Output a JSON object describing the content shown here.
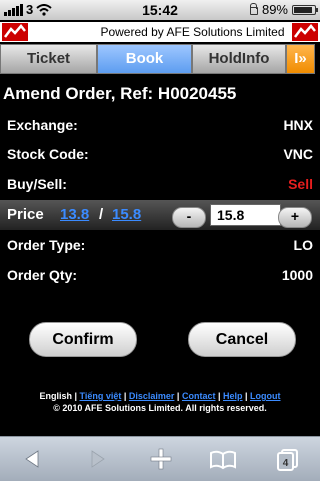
{
  "status_bar": {
    "carrier": "3",
    "time": "15:42",
    "battery": "89%",
    "battery_level": 0.89
  },
  "brand": {
    "powered_by": "Powered by AFE Solutions Limited"
  },
  "tabs": [
    {
      "label": "Ticket",
      "active": false
    },
    {
      "label": "Book",
      "active": true
    },
    {
      "label": "HoldInfo",
      "active": false
    },
    {
      "label": "I»",
      "active": false
    }
  ],
  "order": {
    "title": "Amend Order, Ref: H0020455",
    "fields": [
      {
        "label": "Exchange:",
        "value": "HNX"
      },
      {
        "label": "Stock Code:",
        "value": "VNC"
      },
      {
        "label": "Buy/Sell:",
        "value": "Sell"
      },
      {
        "label": "Order Type:",
        "value": "LO"
      },
      {
        "label": "Order Qty:",
        "value": "1000"
      }
    ],
    "price": {
      "label": "Price",
      "bid": "13.8",
      "separator": "/",
      "ask": "15.8",
      "minus": "-",
      "plus": "+",
      "value": "15.8"
    }
  },
  "actions": {
    "confirm": "Confirm",
    "cancel": "Cancel"
  },
  "footer": {
    "links": [
      "English",
      "Tiếng việt",
      "Disclaimer",
      "Contact",
      "Help",
      "Logout"
    ],
    "separator": " | ",
    "copyright": "© 2010 AFE Solutions Limited. All rights reserved."
  },
  "toolbar": {
    "icons": [
      "back-icon",
      "forward-icon",
      "add-icon",
      "bookmarks-icon",
      "pages-icon"
    ],
    "pages_count": "4"
  },
  "colors": {
    "sell": "#e61e1e",
    "link": "#3b8bff",
    "active_tab": "#5d9df0",
    "more_tab": "#f08c00",
    "brand": "#cc0000"
  }
}
